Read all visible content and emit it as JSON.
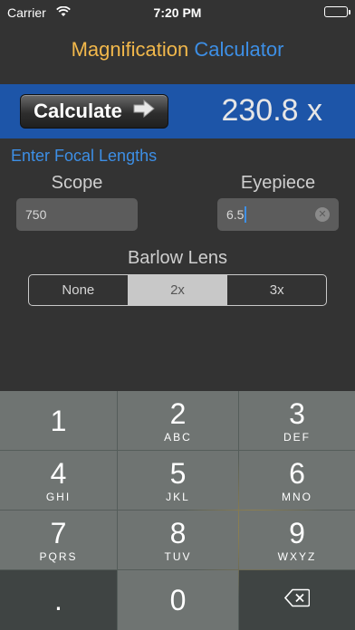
{
  "status_bar": {
    "carrier": "Carrier",
    "time": "7:20 PM"
  },
  "title": {
    "part1": "Magnification",
    "part2": "Calculator"
  },
  "calc": {
    "button_label": "Calculate",
    "result": "230.8 x"
  },
  "inputs": {
    "section_label": "Enter Focal Lengths",
    "scope_label": "Scope",
    "scope_value": "750",
    "eyepiece_label": "Eyepiece",
    "eyepiece_value": "6.5"
  },
  "barlow": {
    "label": "Barlow Lens",
    "options": [
      "None",
      "2x",
      "3x"
    ],
    "selected": "2x"
  },
  "keypad": {
    "keys": [
      {
        "digit": "1",
        "letters": ""
      },
      {
        "digit": "2",
        "letters": "ABC"
      },
      {
        "digit": "3",
        "letters": "DEF"
      },
      {
        "digit": "4",
        "letters": "GHI"
      },
      {
        "digit": "5",
        "letters": "JKL"
      },
      {
        "digit": "6",
        "letters": "MNO"
      },
      {
        "digit": "7",
        "letters": "PQRS"
      },
      {
        "digit": "8",
        "letters": "TUV"
      },
      {
        "digit": "9",
        "letters": "WXYZ"
      }
    ],
    "decimal": ".",
    "zero": "0"
  },
  "colors": {
    "accent_blue": "#3d8fe6",
    "accent_orange": "#f2b84b",
    "band": "#1d55a8",
    "background": "#333333"
  }
}
